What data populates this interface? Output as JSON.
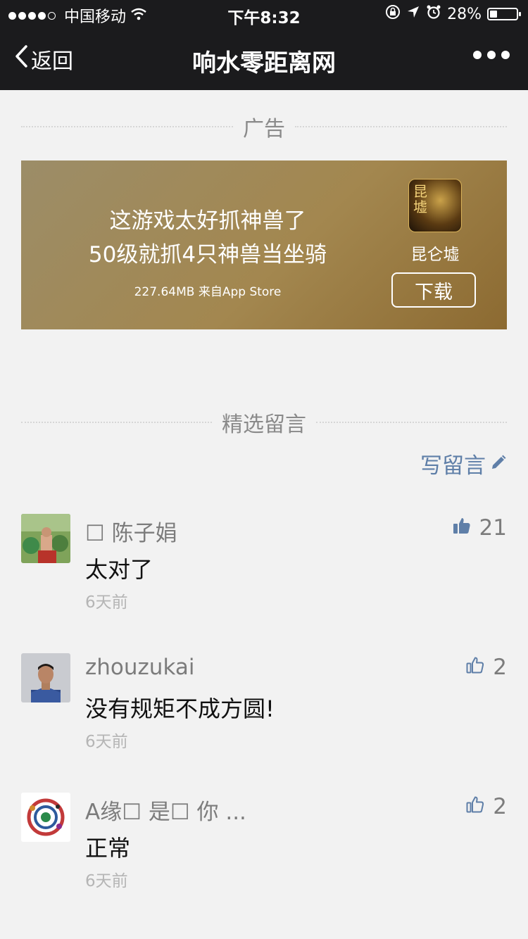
{
  "status_bar": {
    "carrier": "中国移动",
    "time": "下午8:32",
    "battery": "28%",
    "battery_level": 0.28
  },
  "nav": {
    "back_label": "返回",
    "title": "响水零距离网"
  },
  "ad_section": {
    "title": "广告",
    "line1": "这游戏太好抓神兽了",
    "line2": "50级就抓4只神兽当坐骑",
    "meta": "227.64MB 来自App Store",
    "app_name": "昆仑墟",
    "download_label": "下载",
    "icon_text": "昆仑墟"
  },
  "comments_section": {
    "title": "精选留言",
    "write_label": "写留言"
  },
  "comments": [
    {
      "name": "☐ 陈子娟",
      "text": "太对了",
      "time": "6天前",
      "likes": "21",
      "liked": true
    },
    {
      "name": "zhouzukai",
      "text": "没有规矩不成方圆!",
      "time": "6天前",
      "likes": "2",
      "liked": false
    },
    {
      "name": "A缘☐ 是☐ 你 ...",
      "text": "正常",
      "time": "6天前",
      "likes": "2",
      "liked": false
    }
  ],
  "colors": {
    "topbar": "#1b1b1d",
    "background": "#f2f2f2",
    "link": "#5f7fa8",
    "ad_gradient_start": "#9c8d68",
    "ad_gradient_end": "#8c6a31"
  }
}
